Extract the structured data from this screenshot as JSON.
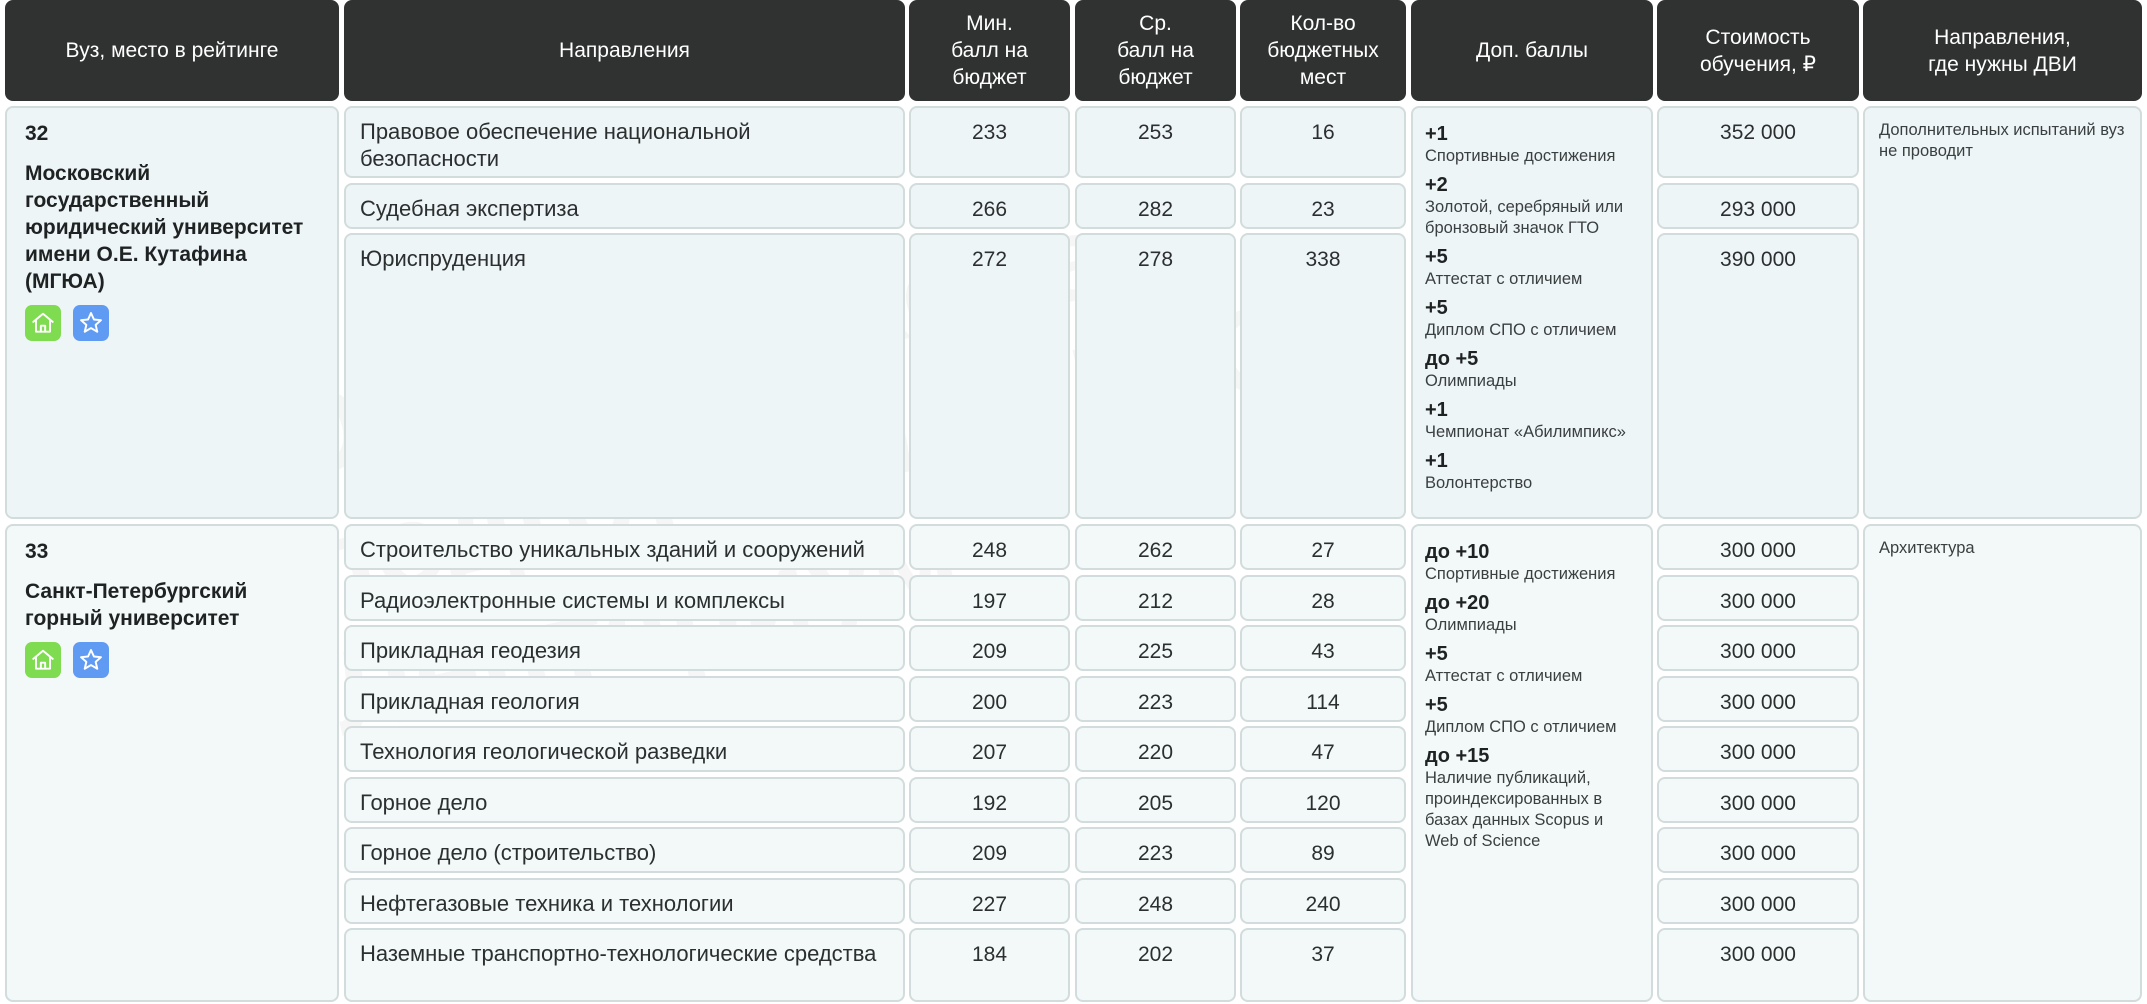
{
  "headers": {
    "university": "Вуз, место в рейтинге",
    "directions": "Направления",
    "min_score": "Мин.\nбалл на\nбюджет",
    "avg_score": "Ср.\nбалл на\nбюджет",
    "budget_places": "Кол-во\nбюджетных\nмест",
    "extra_points": "Доп. баллы",
    "cost": "Стоимость\nобучения, ₽",
    "dvi": "Направления,\nгде нужны ДВИ"
  },
  "universities": [
    {
      "rank": "32",
      "name": "Московский государственный юридический университет имени О.Е. Кутафина (МГЮА)",
      "programs": [
        {
          "name": "Правовое обеспечение национальной безопасности",
          "min": "233",
          "avg": "253",
          "places": "16",
          "cost": "352 000"
        },
        {
          "name": "Судебная экспертиза",
          "min": "266",
          "avg": "282",
          "places": "23",
          "cost": "293 000"
        },
        {
          "name": "Юриспруденция",
          "min": "272",
          "avg": "278",
          "places": "338",
          "cost": "390 000"
        }
      ],
      "bonuses": [
        {
          "value": "+1",
          "label": "Спортивные достижения"
        },
        {
          "value": "+2",
          "label": "Золотой, серебряный или бронзовый значок ГТО"
        },
        {
          "value": "+5",
          "label": "Аттестат с отличием"
        },
        {
          "value": "+5",
          "label": "Диплом СПО с отличием"
        },
        {
          "value": "до +5",
          "label": "Олимпиады"
        },
        {
          "value": "+1",
          "label": "Чемпионат «Абилимпикс»"
        },
        {
          "value": "+1",
          "label": "Волонтерство"
        }
      ],
      "dvi": "Дополнительных испытаний вуз не проводит"
    },
    {
      "rank": "33",
      "name": "Санкт-Петербургский горный университет",
      "programs": [
        {
          "name": "Строительство уникальных зданий и сооружений",
          "min": "248",
          "avg": "262",
          "places": "27",
          "cost": "300 000"
        },
        {
          "name": "Радиоэлектронные системы и комплексы",
          "min": "197",
          "avg": "212",
          "places": "28",
          "cost": "300 000"
        },
        {
          "name": "Прикладная геодезия",
          "min": "209",
          "avg": "225",
          "places": "43",
          "cost": "300 000"
        },
        {
          "name": "Прикладная геология",
          "min": "200",
          "avg": "223",
          "places": "114",
          "cost": "300 000"
        },
        {
          "name": "Технология геологической разведки",
          "min": "207",
          "avg": "220",
          "places": "47",
          "cost": "300 000"
        },
        {
          "name": "Горное дело",
          "min": "192",
          "avg": "205",
          "places": "120",
          "cost": "300 000"
        },
        {
          "name": "Горное дело (строительство)",
          "min": "209",
          "avg": "223",
          "places": "89",
          "cost": "300 000"
        },
        {
          "name": "Нефтегазовые техника и технологии",
          "min": "227",
          "avg": "248",
          "places": "240",
          "cost": "300 000"
        },
        {
          "name": "Наземные транспортно-технологические средства",
          "min": "184",
          "avg": "202",
          "places": "37",
          "cost": "300 000"
        }
      ],
      "bonuses": [
        {
          "value": "до +10",
          "label": "Спортивные достижения"
        },
        {
          "value": "до +20",
          "label": "Олимпиады"
        },
        {
          "value": "+5",
          "label": "Аттестат с отличием"
        },
        {
          "value": "+5",
          "label": "Диплом СПО с отличием"
        },
        {
          "value": "до +15",
          "label": "Наличие публикаций, проиндексированных в базах данных Scopus и Web of Science"
        }
      ],
      "dvi": "Архитектура"
    }
  ],
  "icons": [
    "home-icon",
    "star-icon"
  ],
  "watermark": "Онлайн-школа\nподготовки к ЕГЭ\nЛентариум"
}
